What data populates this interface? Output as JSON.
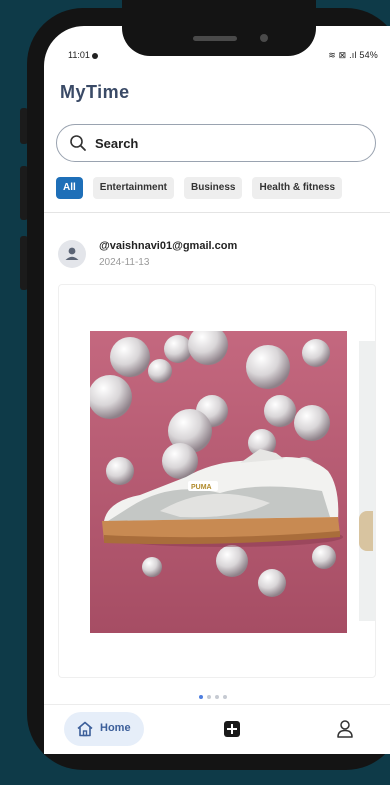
{
  "status_bar": {
    "time": "11:01",
    "right": "≋ ⊠ .ıl 54%"
  },
  "app": {
    "title": "MyTime"
  },
  "search": {
    "placeholder": "Search"
  },
  "categories": [
    "All",
    "Entertainment",
    "Business",
    "Health & fitness"
  ],
  "active_category": "All",
  "post": {
    "user": "@vaishnavi01@gmail.com",
    "date": "2024-11-13",
    "image_icon": "sneaker-photo",
    "carousel_pages": 4,
    "carousel_active": 1
  },
  "nav": {
    "home_label": "Home"
  },
  "colors": {
    "background": "#0e3a48",
    "accent": "#1e6fb8",
    "title": "#3a4a66",
    "photo_backdrop": "#b85a72"
  }
}
